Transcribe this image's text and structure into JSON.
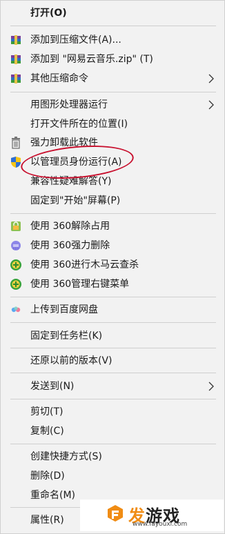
{
  "menu": {
    "open": "打开(O)",
    "add_archive": "添加到压缩文件(A)...",
    "add_zip": "添加到 \"网易云音乐.zip\" (T)",
    "other_compress": "其他压缩命令",
    "run_gpu": "用图形处理器运行",
    "open_location": "打开文件所在的位置(I)",
    "force_uninstall": "强力卸载此软件",
    "run_admin": "以管理员身份运行(A)",
    "compat": "兼容性疑难解答(Y)",
    "pin_start": "固定到\"开始\"屏幕(P)",
    "unlock_360": "使用 360解除占用",
    "force_delete_360": "使用 360强力删除",
    "scan_360": "使用 360进行木马云查杀",
    "manage_menu_360": "使用 360管理右键菜单",
    "upload_baidu": "上传到百度网盘",
    "pin_taskbar": "固定到任务栏(K)",
    "restore_prev": "还原以前的版本(V)",
    "send_to": "发送到(N)",
    "cut": "剪切(T)",
    "copy": "复制(C)",
    "create_shortcut": "创建快捷方式(S)",
    "delete": "删除(D)",
    "rename": "重命名(M)",
    "properties": "属性(R)"
  },
  "icons": {
    "archive": "winrar-archive-icon",
    "trash": "trash-can-icon",
    "shield": "uac-shield-icon",
    "lock_360": "360-unlock-icon",
    "shredder_360": "360-shredder-icon",
    "plus_360": "360-plus-icon",
    "baidu": "baidu-netdisk-icon"
  },
  "colors": {
    "menu_bg": "#f2f2f2",
    "highlight_ring": "#c8102e",
    "watermark_accent": "#f08c14"
  },
  "watermark": {
    "logo_accent": "发",
    "logo_rest": "游戏",
    "url": "www.fayouxi.com"
  }
}
